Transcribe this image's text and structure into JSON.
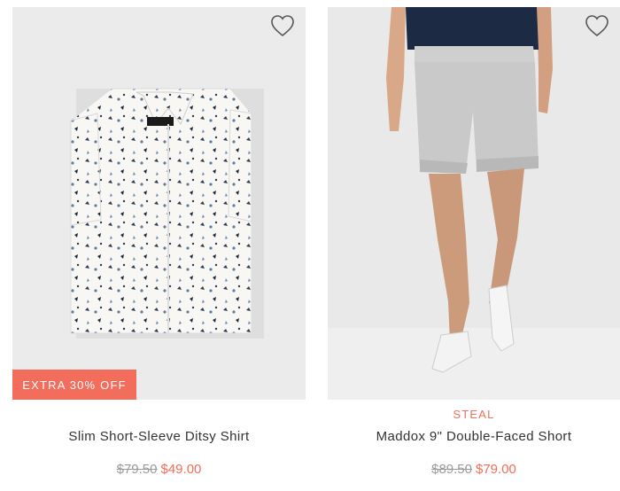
{
  "products": [
    {
      "name": "Slim Short-Sleeve Ditsy Shirt",
      "badge": "EXTRA 30% OFF",
      "old_price": "$79.50",
      "new_price": "$49.00",
      "favorite_icon": "heart-outline-icon"
    },
    {
      "tag": "STEAL",
      "name": "Maddox 9\" Double-Faced Short",
      "old_price": "$89.50",
      "new_price": "$79.00",
      "favorite_icon": "heart-outline-icon"
    }
  ],
  "colors": {
    "accent": "#f26d5b",
    "text": "#333333",
    "muted": "#9a9a9a"
  }
}
